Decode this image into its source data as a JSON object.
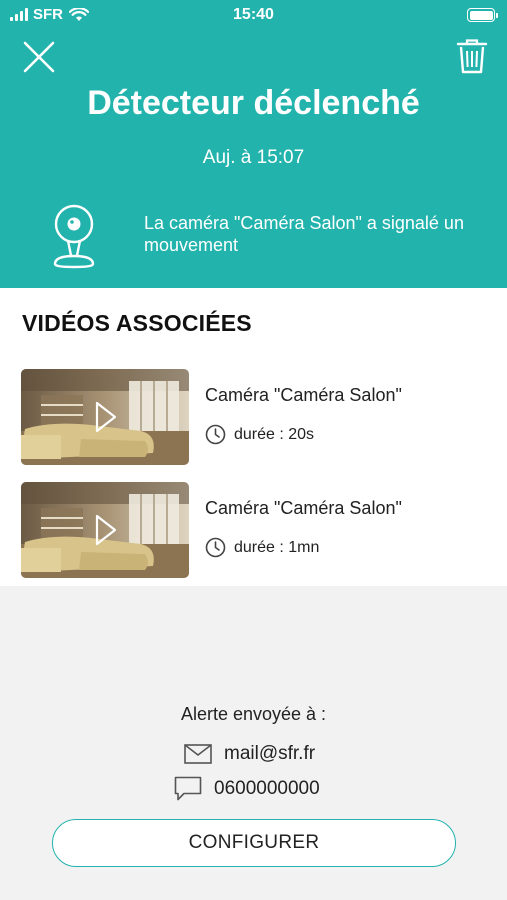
{
  "status_bar": {
    "carrier": "SFR",
    "time": "15:40",
    "signal_bars": 4,
    "battery_level": 1.0
  },
  "header": {
    "title": "Détecteur déclenché",
    "subtitle": "Auj. à 15:07",
    "message": "La caméra \"Caméra Salon\" a signalé un mouvement",
    "background_color": "#23b3ad"
  },
  "videos": {
    "section_title": "VIDÉOS ASSOCIÉES",
    "items": [
      {
        "title": "Caméra \"Caméra Salon\"",
        "duration": "durée : 20s"
      },
      {
        "title": "Caméra \"Caméra Salon\"",
        "duration": "durée : 1mn"
      }
    ]
  },
  "alert": {
    "label": "Alerte envoyée à :",
    "email": "mail@sfr.fr",
    "phone": "0600000000"
  },
  "configure_button": "CONFIGURER",
  "icons": [
    "close-icon",
    "trash-icon",
    "camera-icon",
    "play-icon",
    "clock-icon",
    "mail-icon",
    "message-icon"
  ]
}
